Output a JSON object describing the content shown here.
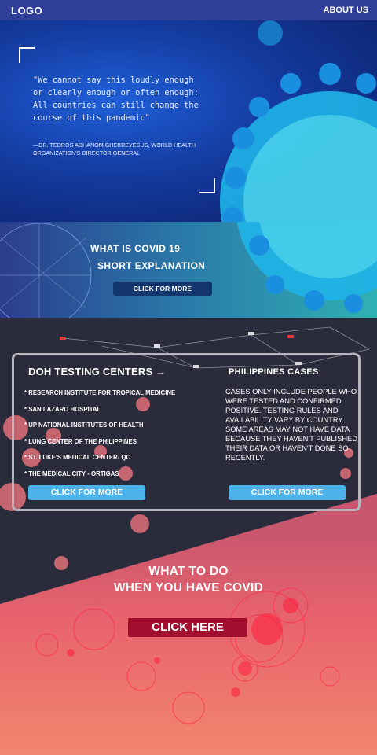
{
  "nav": {
    "logo": "LOGO",
    "about": "ABOUT US"
  },
  "hero": {
    "quote": "\"We cannot say this loudly enough or clearly enough or often enough: All countries can still change the course of this pandemic\"",
    "author": "—DR. TEDROS ADHANOM GHEBREYESUS, WORLD HEALTH ORGANIZATION'S DIRECTOR GENERAL"
  },
  "explainer": {
    "title1": "WHAT IS COVID 19",
    "title2": "SHORT EXPLANATION",
    "button": "CLICK FOR MORE"
  },
  "testing": {
    "title": "DOH TESTING CENTERS",
    "items": [
      "* RESEARCH INSTITUTE FOR TROPICAL MEDICINE",
      "* SAN LAZARO HOSPITAL",
      "* UP NATIONAL INSTITUTES OF HEALTH",
      "* LUNG CENTER OF THE PHILIPPINES",
      "* ST. LUKE'S MEDICAL CENTER- QC",
      "* THE MEDICAL CITY - ORTIGAS"
    ],
    "button": "CLICK FOR MORE"
  },
  "cases": {
    "title": "PHILIPPINES CASES",
    "text": "CASES ONLY INCLUDE PEOPLE WHO WERE TESTED AND CONFIRMED POSITIVE. TESTING RULES AND AVAILABILITY VARY BY COUNTRY. SOME AREAS MAY NOT HAVE DATA BECAUSE THEY HAVEN'T PUBLISHED THEIR DATA OR HAVEN'T DONE SO RECENTLY.",
    "button": "CLICK FOR MORE"
  },
  "todo": {
    "line1": "WHAT TO DO",
    "line2": "WHEN YOU HAVE COVID",
    "button": "CLICK HERE"
  },
  "colors": {
    "nav": "#2f3f98",
    "accent_blue": "#4eb2ea",
    "dark_button": "#13366f",
    "red_button": "#a10e2e"
  }
}
